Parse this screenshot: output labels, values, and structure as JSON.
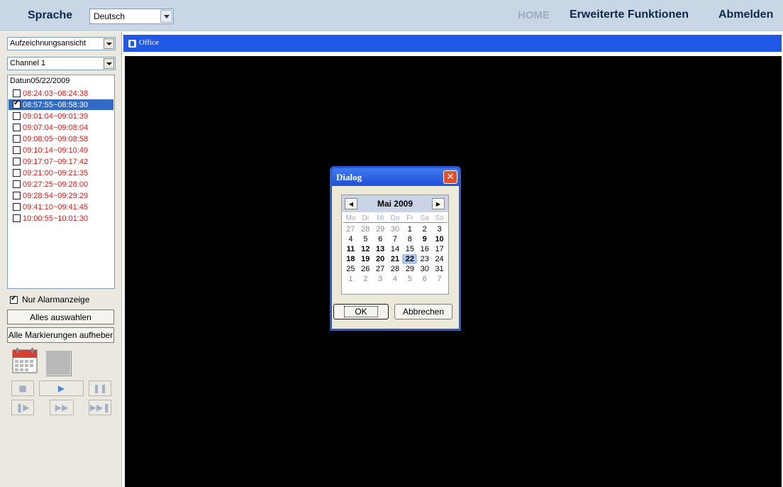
{
  "topbar": {
    "language_label": "Sprache",
    "language_value": "Deutsch",
    "home": "HOME",
    "advanced": "Erweiterte Funktionen",
    "logout": "Abmelden"
  },
  "sidebar": {
    "view_value": "Aufzeichnungsansicht",
    "channel_value": "Channel 1",
    "date_label": "Datun05/22/2009",
    "records": [
      {
        "time": "08:24:03~08:24:38",
        "checked": false
      },
      {
        "time": "08:57:55~08:58:30",
        "checked": true
      },
      {
        "time": "09:01:04~09:01:39",
        "checked": false
      },
      {
        "time": "09:07:04~09:08:04",
        "checked": false
      },
      {
        "time": "09:08:05~09:08:58",
        "checked": false
      },
      {
        "time": "09:10:14~09:10:49",
        "checked": false
      },
      {
        "time": "09:17:07~09:17:42",
        "checked": false
      },
      {
        "time": "09:21:00~09:21:35",
        "checked": false
      },
      {
        "time": "09:27:25~09:28:00",
        "checked": false
      },
      {
        "time": "09:28:54~09:29:29",
        "checked": false
      },
      {
        "time": "09:41:10~09:41:45",
        "checked": false
      },
      {
        "time": "10:00:55~10:01:30",
        "checked": false
      }
    ],
    "alarm_only_label": "Nur Alarmanzeige",
    "select_all_label": "Alles auswahlen",
    "clear_marks_label": "Alle Markierungen aufheber"
  },
  "player": {
    "controls": [
      "stop",
      "play",
      "pause",
      "step",
      "fast-forward",
      "next"
    ]
  },
  "video": {
    "camera_name": "Office"
  },
  "dialog": {
    "title": "Dialog",
    "month_label": "Mai 2009",
    "weekdays": [
      "Mo",
      "Di",
      "Mi",
      "Do",
      "Fr",
      "Sa",
      "So"
    ],
    "weeks": [
      [
        "27",
        "28",
        "29",
        "30",
        "1",
        "2",
        "3"
      ],
      [
        "4",
        "5",
        "6",
        "7",
        "8",
        "9",
        "10"
      ],
      [
        "11",
        "12",
        "13",
        "14",
        "15",
        "16",
        "17"
      ],
      [
        "18",
        "19",
        "20",
        "21",
        "22",
        "23",
        "24"
      ],
      [
        "25",
        "26",
        "27",
        "28",
        "29",
        "30",
        "31"
      ],
      [
        "1",
        "2",
        "3",
        "4",
        "5",
        "6",
        "7"
      ]
    ],
    "selected_day": "22",
    "ok_label": "OK",
    "cancel_label": "Abbrechen"
  },
  "colors": {
    "header_bg": "#c9d6e6",
    "title_bar": "#1f58e6",
    "record_text": "#e01818",
    "selection": "#316ac5"
  }
}
